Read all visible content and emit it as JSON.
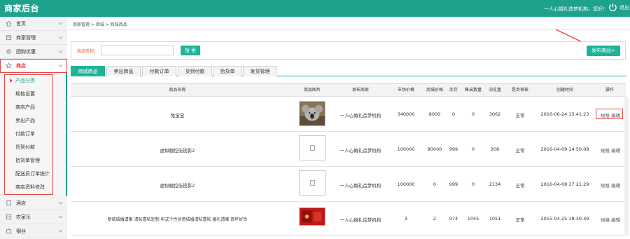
{
  "header": {
    "brand": "商家后台",
    "welcome": "一人心婚礼造梦机构，您好！",
    "logout_label": "退出"
  },
  "sidebar": {
    "items": [
      {
        "label": "首页",
        "icon": "home-icon"
      },
      {
        "label": "商家管理",
        "icon": "store-icon"
      },
      {
        "label": "团购优惠",
        "icon": "gear-icon"
      },
      {
        "label": "商店",
        "icon": "star-icon"
      },
      {
        "label": "酒店",
        "icon": "hotel-icon"
      },
      {
        "label": "农家乐",
        "icon": "farm-icon"
      },
      {
        "label": "钢丝",
        "icon": "tools-icon"
      }
    ],
    "subitems": [
      "产品分类",
      "规格设置",
      "商店产品",
      "卖出产品",
      "付款订单",
      "货到付款",
      "拾货单管理",
      "配送员订单统计",
      "商店资料修改"
    ]
  },
  "breadcrumb": "商家管理 > 商城 > 商城商品",
  "search": {
    "label": "商品名称：",
    "value": "",
    "placeholder": "",
    "button": "搜 索",
    "publish_button": "发布商品+"
  },
  "tabs": [
    "商城商品",
    "卖出商品",
    "付款订单",
    "货到付款",
    "拾货单",
    "发货管理"
  ],
  "table": {
    "columns": [
      "商品名称",
      "商品图片",
      "发布商家",
      "市场价格",
      "商城价格",
      "库存",
      "售出数量",
      "浏览量",
      "是否审核",
      "创建时间",
      "操作"
    ],
    "rows": [
      {
        "name": "兔宝宝",
        "image": "koala-photo",
        "merchant": "一人心婚礼造梦机构",
        "market_price": "340000",
        "shop_price": "8000",
        "stock": "0",
        "sold": "0",
        "views": "3062",
        "audited": "正常",
        "created": "2016-06-24 15:41:23",
        "ops": "规格 编辑"
      },
      {
        "name": "虚拟触控街投影2",
        "image": "broken-image",
        "merchant": "一人心婚礼造梦机构",
        "market_price": "100000",
        "shop_price": "80000",
        "stock": "999",
        "sold": "0",
        "views": "208",
        "audited": "正常",
        "created": "2016-04-09 14:50:08",
        "ops": "规格 编辑"
      },
      {
        "name": "虚拟触控街投影2",
        "image": "broken-image",
        "merchant": "一人心婚礼造梦机构",
        "market_price": "100000",
        "shop_price": "0",
        "stock": "999",
        "sold": "0",
        "views": "2134",
        "audited": "正常",
        "created": "2016-04-08 17:21:29",
        "ops": "规格 编辑"
      },
      {
        "name": "新款结婚请柬 请帖喜帖定制 中式个性创意结婚请帖喜帖 婚礼请柬 百年好合",
        "image": "red-invitation-photo",
        "merchant": "一人心婚礼造梦机构",
        "market_price": "3",
        "shop_price": "2",
        "stock": "974",
        "sold": "1045",
        "views": "1051",
        "audited": "正常",
        "created": "2015-04-25 18:30:49",
        "ops": "规格 编辑"
      }
    ]
  },
  "colors": {
    "primary": "#1fa28c",
    "button": "#1fb397",
    "highlight": "#e54646"
  }
}
